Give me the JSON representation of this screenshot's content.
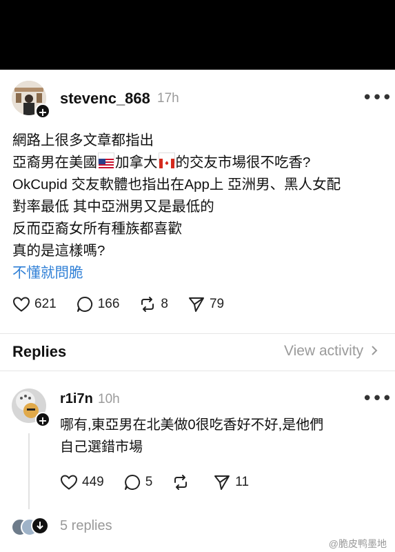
{
  "post": {
    "username": "stevenc_868",
    "time": "17h",
    "lines": [
      "網路上很多文章都指出",
      "亞裔男在美國",
      "加拿大",
      "的交友市場很不吃香?",
      "OkCupid 交友軟體也指出在App上 亞洲男、黑人女配",
      "對率最低 其中亞洲男又是最低的",
      "反而亞裔女所有種族都喜歡",
      "真的是這樣嗎?"
    ],
    "link_text": "不懂就問脆",
    "likes": "621",
    "comments": "166",
    "reposts": "8",
    "shares": "79"
  },
  "replies_header": {
    "title": "Replies",
    "view_activity": "View activity"
  },
  "reply": {
    "username": "r1i7n",
    "time": "10h",
    "lines": [
      "哪有,東亞男在北美做0很吃香好不好,是他們",
      "自己選錯市場"
    ],
    "likes": "449",
    "comments": "5",
    "shares": "11",
    "replies_count": "5 replies"
  },
  "watermark": "@脆皮鸭墨地",
  "icons": {
    "like": "heart-icon",
    "comment": "comment-bubble-icon",
    "repost": "repost-icon",
    "share": "send-icon",
    "more": "more-icon",
    "follow": "plus-icon"
  }
}
